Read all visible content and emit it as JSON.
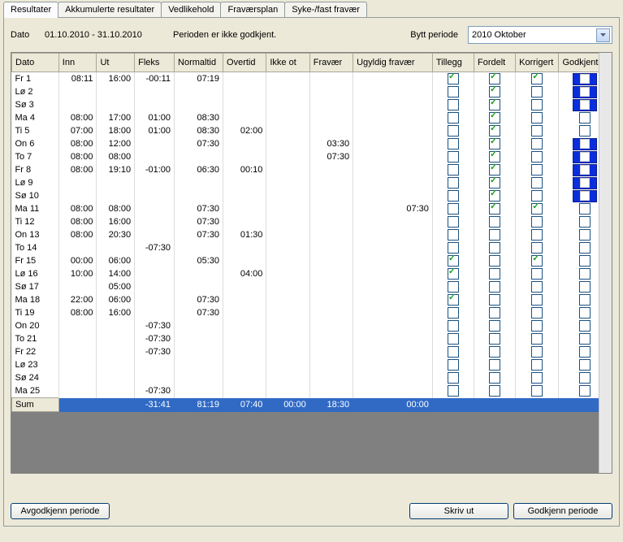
{
  "tabs": [
    "Resultater",
    "Akkumulerte resultater",
    "Vedlikehold",
    "Fraværsplan",
    "Syke-/fast fravær"
  ],
  "activeTab": 0,
  "infobar": {
    "dateLabel": "Dato",
    "range": "01.10.2010 - 31.10.2010",
    "status": "Perioden er ikke godkjent.",
    "switchLabel": "Bytt periode",
    "periodValue": "2010 Oktober"
  },
  "columns": [
    "Dato",
    "Inn",
    "Ut",
    "Fleks",
    "Normaltid",
    "Overtid",
    "Ikke ot",
    "Fravær",
    "Ugyldig fravær",
    "Tillegg",
    "Fordelt",
    "Korrigert",
    "Godkjent"
  ],
  "rows": [
    {
      "d": "Fr 1",
      "inn": "08:11",
      "ut": "16:00",
      "fleks": "-00:11",
      "norm": "07:19",
      "over": "",
      "ikke": "",
      "fra": "",
      "ugy": "",
      "til": true,
      "for": true,
      "kor": true,
      "god": "B"
    },
    {
      "d": "Lø 2",
      "inn": "",
      "ut": "",
      "fleks": "",
      "norm": "",
      "over": "",
      "ikke": "",
      "fra": "",
      "ugy": "",
      "til": false,
      "for": true,
      "kor": false,
      "god": "B"
    },
    {
      "d": "Sø 3",
      "inn": "",
      "ut": "",
      "fleks": "",
      "norm": "",
      "over": "",
      "ikke": "",
      "fra": "",
      "ugy": "",
      "til": false,
      "for": true,
      "kor": false,
      "god": "B"
    },
    {
      "d": "Ma 4",
      "inn": "08:00",
      "ut": "17:00",
      "fleks": "01:00",
      "norm": "08:30",
      "over": "",
      "ikke": "",
      "fra": "",
      "ugy": "",
      "til": false,
      "for": true,
      "kor": false,
      "god": "U"
    },
    {
      "d": "Ti 5",
      "inn": "07:00",
      "ut": "18:00",
      "fleks": "01:00",
      "norm": "08:30",
      "over": "02:00",
      "ikke": "",
      "fra": "",
      "ugy": "",
      "til": false,
      "for": true,
      "kor": false,
      "god": "U"
    },
    {
      "d": "On 6",
      "inn": "08:00",
      "ut": "12:00",
      "fleks": "",
      "norm": "07:30",
      "over": "",
      "ikke": "",
      "fra": "03:30",
      "ugy": "",
      "til": false,
      "for": true,
      "kor": false,
      "god": "B"
    },
    {
      "d": "To 7",
      "inn": "08:00",
      "ut": "08:00",
      "fleks": "",
      "norm": "",
      "over": "",
      "ikke": "",
      "fra": "07:30",
      "ugy": "",
      "til": false,
      "for": true,
      "kor": false,
      "god": "B"
    },
    {
      "d": "Fr 8",
      "inn": "08:00",
      "ut": "19:10",
      "fleks": "-01:00",
      "norm": "06:30",
      "over": "00:10",
      "ikke": "",
      "fra": "",
      "ugy": "",
      "til": false,
      "for": true,
      "kor": false,
      "god": "B"
    },
    {
      "d": "Lø 9",
      "inn": "",
      "ut": "",
      "fleks": "",
      "norm": "",
      "over": "",
      "ikke": "",
      "fra": "",
      "ugy": "",
      "til": false,
      "for": true,
      "kor": false,
      "god": "B"
    },
    {
      "d": "Sø 10",
      "inn": "",
      "ut": "",
      "fleks": "",
      "norm": "",
      "over": "",
      "ikke": "",
      "fra": "",
      "ugy": "",
      "til": false,
      "for": true,
      "kor": false,
      "god": "B"
    },
    {
      "d": "Ma 11",
      "inn": "08:00",
      "ut": "08:00",
      "fleks": "",
      "norm": "07:30",
      "over": "",
      "ikke": "",
      "fra": "",
      "ugy": "07:30",
      "til": false,
      "for": true,
      "kor": true,
      "god": "U"
    },
    {
      "d": "Ti 12",
      "inn": "08:00",
      "ut": "16:00",
      "fleks": "",
      "norm": "07:30",
      "over": "",
      "ikke": "",
      "fra": "",
      "ugy": "",
      "til": false,
      "for": false,
      "kor": false,
      "god": "U"
    },
    {
      "d": "On 13",
      "inn": "08:00",
      "ut": "20:30",
      "fleks": "",
      "norm": "07:30",
      "over": "01:30",
      "ikke": "",
      "fra": "",
      "ugy": "",
      "til": false,
      "for": false,
      "kor": false,
      "god": "U"
    },
    {
      "d": "To 14",
      "inn": "",
      "ut": "",
      "fleks": "-07:30",
      "norm": "",
      "over": "",
      "ikke": "",
      "fra": "",
      "ugy": "",
      "til": false,
      "for": false,
      "kor": false,
      "god": "U"
    },
    {
      "d": "Fr 15",
      "inn": "00:00",
      "ut": "06:00",
      "fleks": "",
      "norm": "05:30",
      "over": "",
      "ikke": "",
      "fra": "",
      "ugy": "",
      "til": true,
      "for": false,
      "kor": true,
      "god": "U"
    },
    {
      "d": "Lø 16",
      "inn": "10:00",
      "ut": "14:00",
      "fleks": "",
      "norm": "",
      "over": "04:00",
      "ikke": "",
      "fra": "",
      "ugy": "",
      "til": true,
      "for": false,
      "kor": false,
      "god": "U"
    },
    {
      "d": "Sø 17",
      "inn": "",
      "ut": "05:00",
      "fleks": "",
      "norm": "",
      "over": "",
      "ikke": "",
      "fra": "",
      "ugy": "",
      "til": false,
      "for": false,
      "kor": false,
      "god": "U"
    },
    {
      "d": "Ma 18",
      "inn": "22:00",
      "ut": "06:00",
      "fleks": "",
      "norm": "07:30",
      "over": "",
      "ikke": "",
      "fra": "",
      "ugy": "",
      "til": true,
      "for": false,
      "kor": false,
      "god": "U"
    },
    {
      "d": "Ti 19",
      "inn": "08:00",
      "ut": "16:00",
      "fleks": "",
      "norm": "07:30",
      "over": "",
      "ikke": "",
      "fra": "",
      "ugy": "",
      "til": false,
      "for": false,
      "kor": false,
      "god": "U"
    },
    {
      "d": "On 20",
      "inn": "",
      "ut": "",
      "fleks": "-07:30",
      "norm": "",
      "over": "",
      "ikke": "",
      "fra": "",
      "ugy": "",
      "til": false,
      "for": false,
      "kor": false,
      "god": "U"
    },
    {
      "d": "To 21",
      "inn": "",
      "ut": "",
      "fleks": "-07:30",
      "norm": "",
      "over": "",
      "ikke": "",
      "fra": "",
      "ugy": "",
      "til": false,
      "for": false,
      "kor": false,
      "god": "U"
    },
    {
      "d": "Fr 22",
      "inn": "",
      "ut": "",
      "fleks": "-07:30",
      "norm": "",
      "over": "",
      "ikke": "",
      "fra": "",
      "ugy": "",
      "til": false,
      "for": false,
      "kor": false,
      "god": "U"
    },
    {
      "d": "Lø 23",
      "inn": "",
      "ut": "",
      "fleks": "",
      "norm": "",
      "over": "",
      "ikke": "",
      "fra": "",
      "ugy": "",
      "til": false,
      "for": false,
      "kor": false,
      "god": "U"
    },
    {
      "d": "Sø 24",
      "inn": "",
      "ut": "",
      "fleks": "",
      "norm": "",
      "over": "",
      "ikke": "",
      "fra": "",
      "ugy": "",
      "til": false,
      "for": false,
      "kor": false,
      "god": "U"
    },
    {
      "d": "Ma 25",
      "inn": "",
      "ut": "",
      "fleks": "-07:30",
      "norm": "",
      "over": "",
      "ikke": "",
      "fra": "",
      "ugy": "",
      "til": false,
      "for": false,
      "kor": false,
      "god": "U"
    }
  ],
  "sum": {
    "label": "Sum",
    "fleks": "-31:41",
    "norm": "81:19",
    "over": "07:40",
    "ikke": "00:00",
    "fra": "18:30",
    "ugy": "00:00"
  },
  "buttons": {
    "unapprove": "Avgodkjenn periode",
    "print": "Skriv ut",
    "approve": "Godkjenn periode"
  }
}
